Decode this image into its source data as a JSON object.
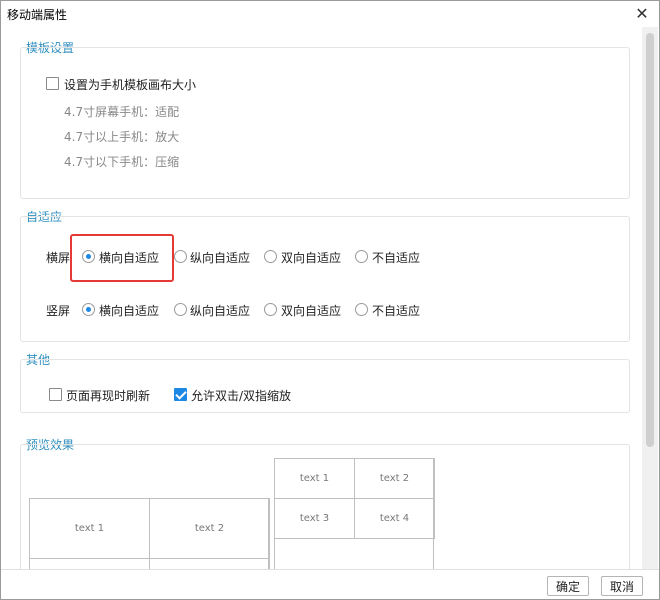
{
  "window": {
    "title": "移动端属性"
  },
  "template_settings": {
    "title": "模板设置",
    "set_canvas_checkbox": {
      "label": "设置为手机模板画布大小",
      "checked": false
    },
    "hints": [
      "4.7寸屏幕手机：适配",
      "4.7寸以上手机：放大",
      "4.7寸以下手机：压缩"
    ]
  },
  "adaptive": {
    "title": "自适应",
    "landscape": {
      "label": "横屏",
      "options": [
        "横向自适应",
        "纵向自适应",
        "双向自适应",
        "不自适应"
      ],
      "selected_index": 0
    },
    "portrait": {
      "label": "竖屏",
      "options": [
        "横向自适应",
        "纵向自适应",
        "双向自适应",
        "不自适应"
      ],
      "selected_index": 0
    }
  },
  "other": {
    "title": "其他",
    "refresh_checkbox": {
      "label": "页面再现时刷新",
      "checked": false
    },
    "zoom_checkbox": {
      "label": "允许双击/双指缩放",
      "checked": true
    }
  },
  "preview": {
    "title": "预览效果",
    "left_cells": [
      "text 1",
      "text 2"
    ],
    "right_cells": [
      "text 1",
      "text 2",
      "text 3",
      "text 4"
    ]
  },
  "footer": {
    "ok_label": "确定",
    "cancel_label": "取消"
  },
  "colors": {
    "accent": "#1e88e5",
    "section_title": "#2f8fbf",
    "highlight": "#e53935"
  }
}
